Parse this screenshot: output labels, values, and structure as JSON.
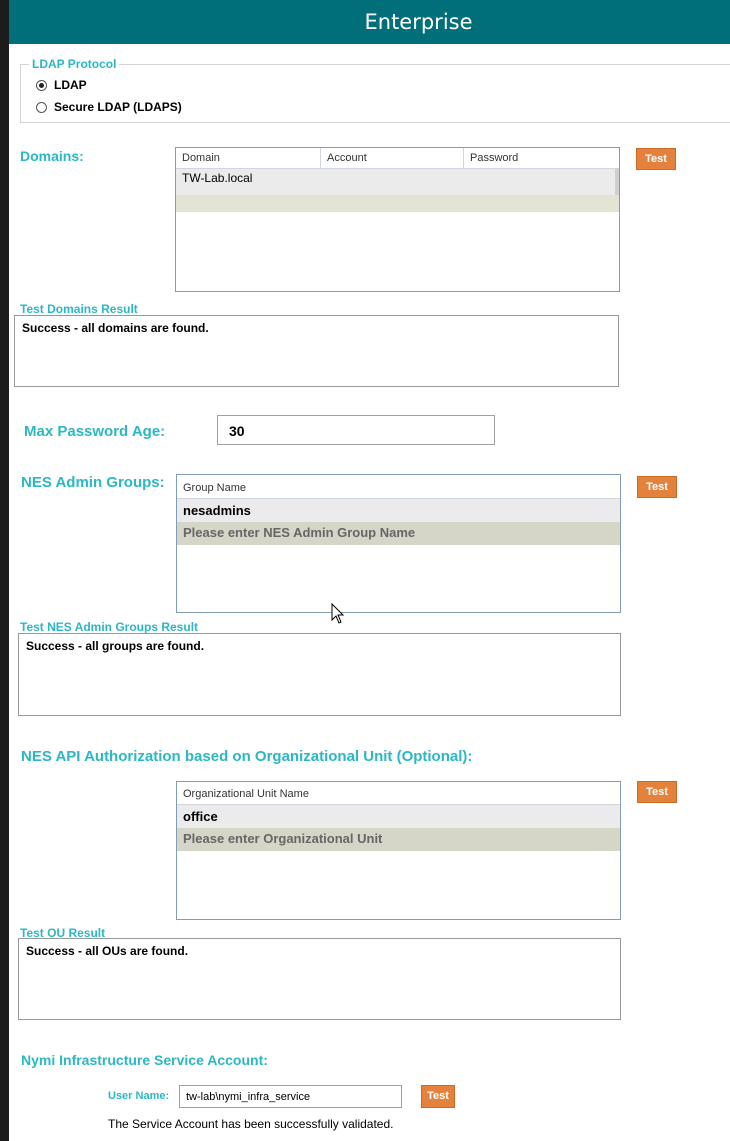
{
  "window": {
    "title": "Enterprise"
  },
  "ldap": {
    "legend": "LDAP Protocol",
    "options": [
      {
        "label": "LDAP",
        "selected": true
      },
      {
        "label": "Secure LDAP (LDAPS)",
        "selected": false
      }
    ]
  },
  "domains": {
    "label": "Domains:",
    "columns": [
      "Domain",
      "Account",
      "Password"
    ],
    "rows": [
      {
        "domain": "TW-Lab.local",
        "account": "",
        "password": ""
      }
    ],
    "test_label": "Test",
    "result_label": "Test Domains Result",
    "result_text": "Success - all domains are found."
  },
  "max_password_age": {
    "label": "Max Password Age:",
    "value": "30"
  },
  "admin_groups": {
    "label": "NES Admin Groups:",
    "column": "Group Name",
    "rows": [
      "nesadmins"
    ],
    "placeholder": "Please enter NES Admin Group Name",
    "test_label": "Test",
    "result_label": "Test NES Admin Groups Result",
    "result_text": "Success - all groups are found."
  },
  "api_ou": {
    "label": "NES API Authorization based on Organizational Unit (Optional):",
    "column": "Organizational Unit Name",
    "rows": [
      "office"
    ],
    "placeholder": "Please enter Organizational Unit",
    "test_label": "Test",
    "result_label": "Test OU Result",
    "result_text": "Success - all OUs are found."
  },
  "service_account": {
    "label": "Nymi Infrastructure Service Account:",
    "user_label": "User Name:",
    "user_value": "tw-lab\\nymi_infra_service",
    "test_label": "Test",
    "status": "The Service Account has been successfully validated."
  },
  "colors": {
    "title_bar": "#006f7a",
    "accent": "#2bb7c4",
    "button": "#e4823d",
    "placeholder_row": "#d5d5c8"
  }
}
